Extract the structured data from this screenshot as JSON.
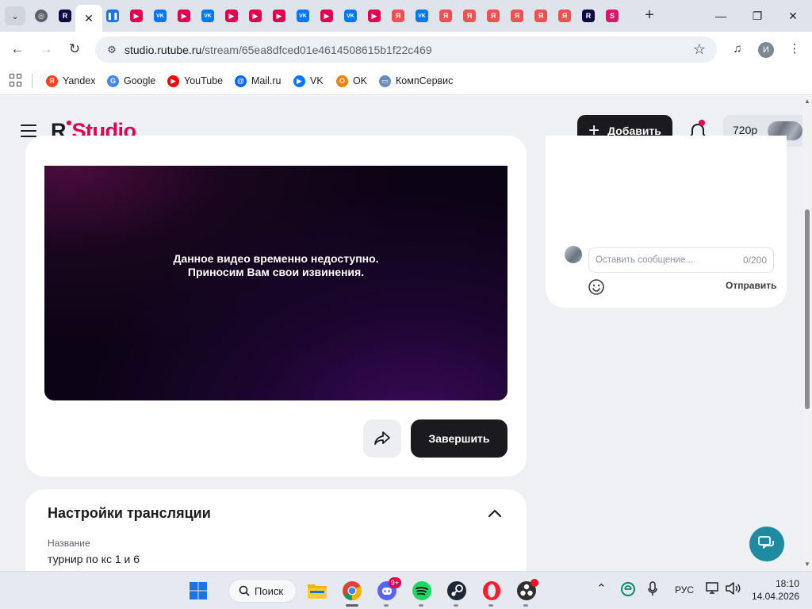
{
  "browser": {
    "tabs": [
      {
        "icon": "chrome-icon",
        "color": "#5f6368"
      },
      {
        "icon": "rutube-icon",
        "color": "#100943"
      },
      {
        "icon": "close-tab-icon",
        "active": true
      },
      {
        "icon": "pause-icon",
        "color": "#1a73e8"
      },
      {
        "icon": "youtube-icon",
        "color": "#e4004f"
      },
      {
        "icon": "vk-icon",
        "color": "#0077ff"
      },
      {
        "icon": "youtube-icon",
        "color": "#e4004f"
      },
      {
        "icon": "vk-icon",
        "color": "#0077ff"
      },
      {
        "icon": "youtube-icon",
        "color": "#e4004f"
      },
      {
        "icon": "youtube-icon",
        "color": "#e4004f"
      },
      {
        "icon": "youtube-icon",
        "color": "#e4004f"
      },
      {
        "icon": "vk-icon",
        "color": "#0077ff"
      },
      {
        "icon": "youtube-icon",
        "color": "#e4004f"
      },
      {
        "icon": "vk-icon",
        "color": "#0077ff"
      },
      {
        "icon": "youtube-icon",
        "color": "#e4004f"
      },
      {
        "icon": "yandex-icon",
        "color": "#f05050"
      },
      {
        "icon": "vk-icon",
        "color": "#0077ff"
      },
      {
        "icon": "yandex-icon",
        "color": "#f05050"
      },
      {
        "icon": "yandex-icon",
        "color": "#f05050"
      },
      {
        "icon": "yandex-icon",
        "color": "#f05050"
      },
      {
        "icon": "yandex-icon",
        "color": "#f05050"
      },
      {
        "icon": "yandex-icon",
        "color": "#f05050"
      },
      {
        "icon": "yandex-icon",
        "color": "#f05050"
      },
      {
        "icon": "rutube-icon",
        "color": "#100943"
      },
      {
        "icon": "s-app-icon",
        "color": "#d6176b"
      }
    ],
    "url_host": "studio.rutube.ru",
    "url_path": "/stream/65ea8dfced01e4614508615b1f22c469",
    "profile_initial": "И",
    "bookmarks": [
      {
        "label": "Yandex",
        "icon": "yandex-icon",
        "color": "#fc3f1d",
        "glyph": "Я"
      },
      {
        "label": "Google",
        "icon": "google-icon",
        "color": "#4285f4",
        "glyph": "G"
      },
      {
        "label": "YouTube",
        "icon": "youtube-icon",
        "color": "#ff0000",
        "glyph": "▶"
      },
      {
        "label": "Mail.ru",
        "icon": "mailru-icon",
        "color": "#0067ff",
        "glyph": "@"
      },
      {
        "label": "VK",
        "icon": "vk-video-icon",
        "color": "#0077ff",
        "glyph": "▶"
      },
      {
        "label": "OK",
        "icon": "ok-icon",
        "color": "#ee8208",
        "glyph": "О"
      },
      {
        "label": "КомпСервис",
        "icon": "monitor-icon",
        "color": "#6b8cb8",
        "glyph": "▭"
      }
    ]
  },
  "header": {
    "logo_r": "R",
    "logo_text": "Studio",
    "add_label": "Добавить",
    "quality_label": "720p"
  },
  "player": {
    "message_line1": "Данное видео временно недоступно.",
    "message_line2": "Приносим Вам свои извинения.",
    "finish_label": "Завершить"
  },
  "chat": {
    "placeholder": "Оставить сообщение...",
    "counter": "0/200",
    "send_label": "Отправить"
  },
  "settings": {
    "title": "Настройки трансляции",
    "field_label": "Название",
    "field_value": "турнир по кс 1 и 6"
  },
  "taskbar": {
    "search_label": "Поиск",
    "discord_badge": "9+",
    "lang": "РУС",
    "time": "18:10",
    "date": "14.04.2026"
  },
  "colors": {
    "accent": "#e4004f",
    "dark_button": "#1b1b1f",
    "support_button": "#1e8ba3"
  }
}
